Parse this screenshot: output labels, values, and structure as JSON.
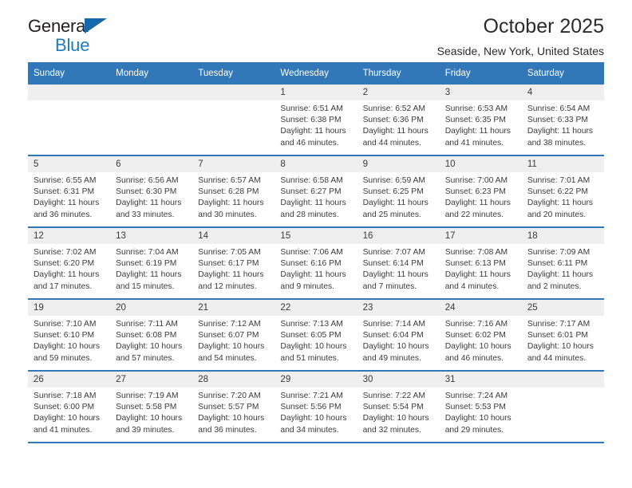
{
  "brand": {
    "name_part1": "General",
    "name_part2": "Blue",
    "triangle_icon": "triangle-icon",
    "color_dark": "#231f20",
    "color_blue": "#1f7bc1"
  },
  "header": {
    "month_title": "October 2025",
    "location": "Seaside, New York, United States"
  },
  "theme": {
    "header_blue": "#3278b8",
    "daynum_bg": "#efefef",
    "text": "#3a3a3a"
  },
  "calendar": {
    "weekday_headers": [
      "Sunday",
      "Monday",
      "Tuesday",
      "Wednesday",
      "Thursday",
      "Friday",
      "Saturday"
    ],
    "weeks": [
      [
        {
          "day": "",
          "sunrise": "",
          "sunset": "",
          "daylight": "",
          "empty": true
        },
        {
          "day": "",
          "sunrise": "",
          "sunset": "",
          "daylight": "",
          "empty": true
        },
        {
          "day": "",
          "sunrise": "",
          "sunset": "",
          "daylight": "",
          "empty": true
        },
        {
          "day": "1",
          "sunrise": "Sunrise: 6:51 AM",
          "sunset": "Sunset: 6:38 PM",
          "daylight": "Daylight: 11 hours and 46 minutes."
        },
        {
          "day": "2",
          "sunrise": "Sunrise: 6:52 AM",
          "sunset": "Sunset: 6:36 PM",
          "daylight": "Daylight: 11 hours and 44 minutes."
        },
        {
          "day": "3",
          "sunrise": "Sunrise: 6:53 AM",
          "sunset": "Sunset: 6:35 PM",
          "daylight": "Daylight: 11 hours and 41 minutes."
        },
        {
          "day": "4",
          "sunrise": "Sunrise: 6:54 AM",
          "sunset": "Sunset: 6:33 PM",
          "daylight": "Daylight: 11 hours and 38 minutes."
        }
      ],
      [
        {
          "day": "5",
          "sunrise": "Sunrise: 6:55 AM",
          "sunset": "Sunset: 6:31 PM",
          "daylight": "Daylight: 11 hours and 36 minutes."
        },
        {
          "day": "6",
          "sunrise": "Sunrise: 6:56 AM",
          "sunset": "Sunset: 6:30 PM",
          "daylight": "Daylight: 11 hours and 33 minutes."
        },
        {
          "day": "7",
          "sunrise": "Sunrise: 6:57 AM",
          "sunset": "Sunset: 6:28 PM",
          "daylight": "Daylight: 11 hours and 30 minutes."
        },
        {
          "day": "8",
          "sunrise": "Sunrise: 6:58 AM",
          "sunset": "Sunset: 6:27 PM",
          "daylight": "Daylight: 11 hours and 28 minutes."
        },
        {
          "day": "9",
          "sunrise": "Sunrise: 6:59 AM",
          "sunset": "Sunset: 6:25 PM",
          "daylight": "Daylight: 11 hours and 25 minutes."
        },
        {
          "day": "10",
          "sunrise": "Sunrise: 7:00 AM",
          "sunset": "Sunset: 6:23 PM",
          "daylight": "Daylight: 11 hours and 22 minutes."
        },
        {
          "day": "11",
          "sunrise": "Sunrise: 7:01 AM",
          "sunset": "Sunset: 6:22 PM",
          "daylight": "Daylight: 11 hours and 20 minutes."
        }
      ],
      [
        {
          "day": "12",
          "sunrise": "Sunrise: 7:02 AM",
          "sunset": "Sunset: 6:20 PM",
          "daylight": "Daylight: 11 hours and 17 minutes."
        },
        {
          "day": "13",
          "sunrise": "Sunrise: 7:04 AM",
          "sunset": "Sunset: 6:19 PM",
          "daylight": "Daylight: 11 hours and 15 minutes."
        },
        {
          "day": "14",
          "sunrise": "Sunrise: 7:05 AM",
          "sunset": "Sunset: 6:17 PM",
          "daylight": "Daylight: 11 hours and 12 minutes."
        },
        {
          "day": "15",
          "sunrise": "Sunrise: 7:06 AM",
          "sunset": "Sunset: 6:16 PM",
          "daylight": "Daylight: 11 hours and 9 minutes."
        },
        {
          "day": "16",
          "sunrise": "Sunrise: 7:07 AM",
          "sunset": "Sunset: 6:14 PM",
          "daylight": "Daylight: 11 hours and 7 minutes."
        },
        {
          "day": "17",
          "sunrise": "Sunrise: 7:08 AM",
          "sunset": "Sunset: 6:13 PM",
          "daylight": "Daylight: 11 hours and 4 minutes."
        },
        {
          "day": "18",
          "sunrise": "Sunrise: 7:09 AM",
          "sunset": "Sunset: 6:11 PM",
          "daylight": "Daylight: 11 hours and 2 minutes."
        }
      ],
      [
        {
          "day": "19",
          "sunrise": "Sunrise: 7:10 AM",
          "sunset": "Sunset: 6:10 PM",
          "daylight": "Daylight: 10 hours and 59 minutes."
        },
        {
          "day": "20",
          "sunrise": "Sunrise: 7:11 AM",
          "sunset": "Sunset: 6:08 PM",
          "daylight": "Daylight: 10 hours and 57 minutes."
        },
        {
          "day": "21",
          "sunrise": "Sunrise: 7:12 AM",
          "sunset": "Sunset: 6:07 PM",
          "daylight": "Daylight: 10 hours and 54 minutes."
        },
        {
          "day": "22",
          "sunrise": "Sunrise: 7:13 AM",
          "sunset": "Sunset: 6:05 PM",
          "daylight": "Daylight: 10 hours and 51 minutes."
        },
        {
          "day": "23",
          "sunrise": "Sunrise: 7:14 AM",
          "sunset": "Sunset: 6:04 PM",
          "daylight": "Daylight: 10 hours and 49 minutes."
        },
        {
          "day": "24",
          "sunrise": "Sunrise: 7:16 AM",
          "sunset": "Sunset: 6:02 PM",
          "daylight": "Daylight: 10 hours and 46 minutes."
        },
        {
          "day": "25",
          "sunrise": "Sunrise: 7:17 AM",
          "sunset": "Sunset: 6:01 PM",
          "daylight": "Daylight: 10 hours and 44 minutes."
        }
      ],
      [
        {
          "day": "26",
          "sunrise": "Sunrise: 7:18 AM",
          "sunset": "Sunset: 6:00 PM",
          "daylight": "Daylight: 10 hours and 41 minutes."
        },
        {
          "day": "27",
          "sunrise": "Sunrise: 7:19 AM",
          "sunset": "Sunset: 5:58 PM",
          "daylight": "Daylight: 10 hours and 39 minutes."
        },
        {
          "day": "28",
          "sunrise": "Sunrise: 7:20 AM",
          "sunset": "Sunset: 5:57 PM",
          "daylight": "Daylight: 10 hours and 36 minutes."
        },
        {
          "day": "29",
          "sunrise": "Sunrise: 7:21 AM",
          "sunset": "Sunset: 5:56 PM",
          "daylight": "Daylight: 10 hours and 34 minutes."
        },
        {
          "day": "30",
          "sunrise": "Sunrise: 7:22 AM",
          "sunset": "Sunset: 5:54 PM",
          "daylight": "Daylight: 10 hours and 32 minutes."
        },
        {
          "day": "31",
          "sunrise": "Sunrise: 7:24 AM",
          "sunset": "Sunset: 5:53 PM",
          "daylight": "Daylight: 10 hours and 29 minutes."
        },
        {
          "day": "",
          "sunrise": "",
          "sunset": "",
          "daylight": "",
          "empty": true
        }
      ]
    ]
  }
}
